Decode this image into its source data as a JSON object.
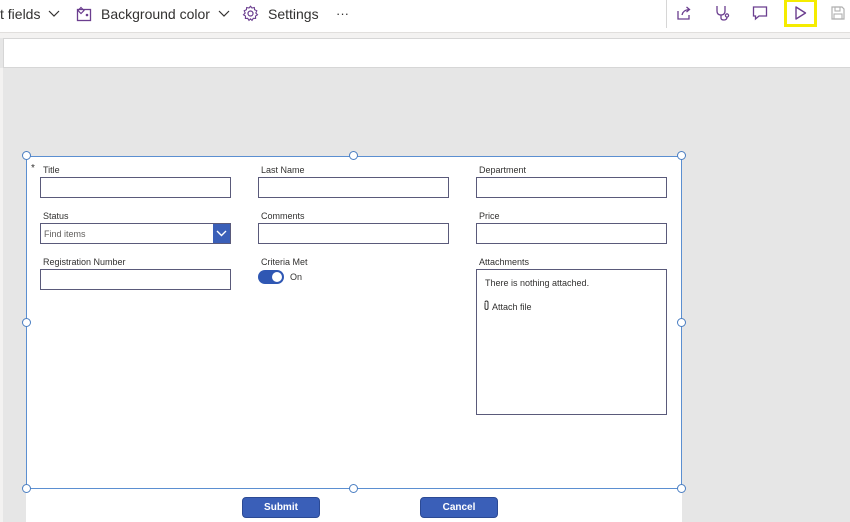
{
  "toolbar": {
    "fields_label": "t fields",
    "background_color_label": "Background color",
    "settings_label": "Settings",
    "more_label": "···"
  },
  "icons": {
    "chevron": "chevron-down-icon",
    "background": "background-color-icon",
    "settings": "gear-icon",
    "share": "share-icon",
    "checker": "stethoscope-icon",
    "comments": "comment-icon",
    "preview": "play-icon",
    "save": "save-icon"
  },
  "colors": {
    "accent": "#3a5fb8",
    "highlight": "#f5ec00",
    "selection": "#5b8fd1",
    "icon_purple": "#6b3e8f"
  },
  "form": {
    "required_mark": "*",
    "fields": {
      "title": {
        "label": "Title",
        "value": ""
      },
      "last_name": {
        "label": "Last Name",
        "value": ""
      },
      "department": {
        "label": "Department",
        "value": ""
      },
      "status": {
        "label": "Status",
        "placeholder": "Find items"
      },
      "comments": {
        "label": "Comments",
        "value": ""
      },
      "price": {
        "label": "Price",
        "value": ""
      },
      "registration_number": {
        "label": "Registration Number",
        "value": ""
      },
      "criteria_met": {
        "label": "Criteria Met",
        "state_text": "On"
      },
      "attachments": {
        "label": "Attachments",
        "empty_text": "There is nothing attached.",
        "attach_text": "Attach file"
      }
    }
  },
  "buttons": {
    "submit": "Submit",
    "cancel": "Cancel"
  }
}
